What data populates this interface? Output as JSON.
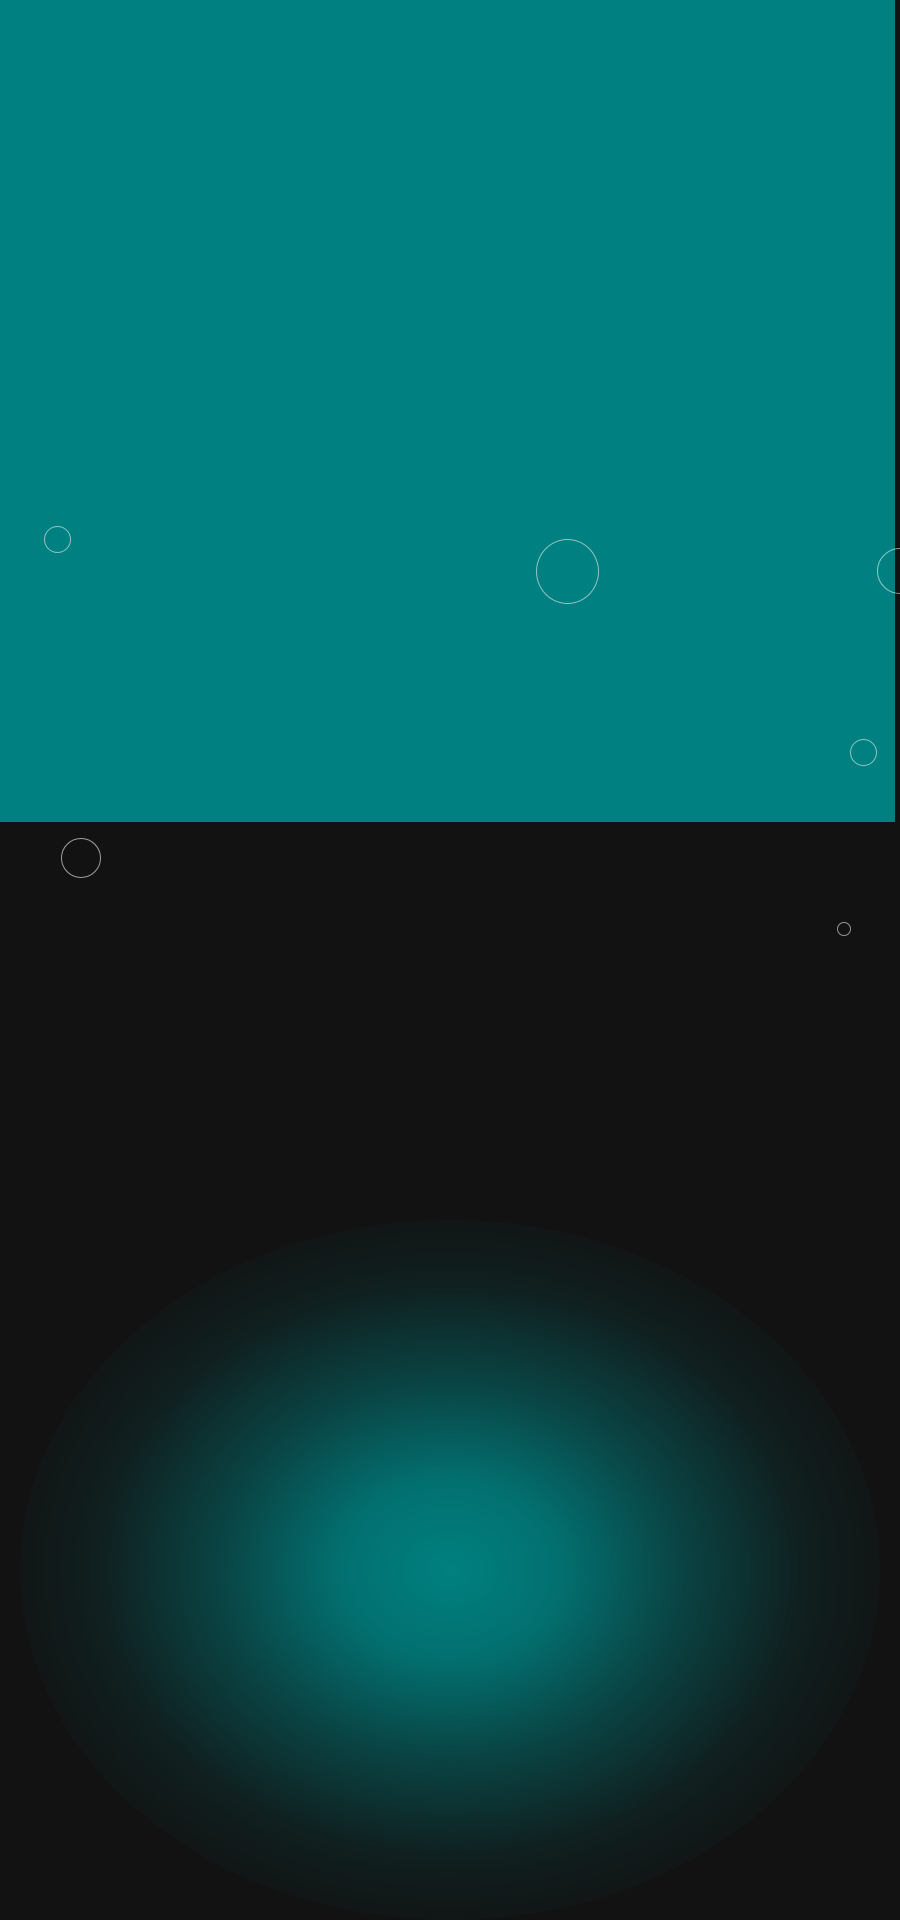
{
  "colors": {
    "hero_background": "#008080",
    "page_background": "#121212",
    "glow_color": "#008080",
    "bubble_outline": "#ffffff"
  },
  "decorations": {
    "bubbles": [
      {
        "name": "bubble-1"
      },
      {
        "name": "bubble-2"
      },
      {
        "name": "bubble-3"
      },
      {
        "name": "bubble-4"
      },
      {
        "name": "bubble-5"
      },
      {
        "name": "bubble-6"
      }
    ]
  }
}
